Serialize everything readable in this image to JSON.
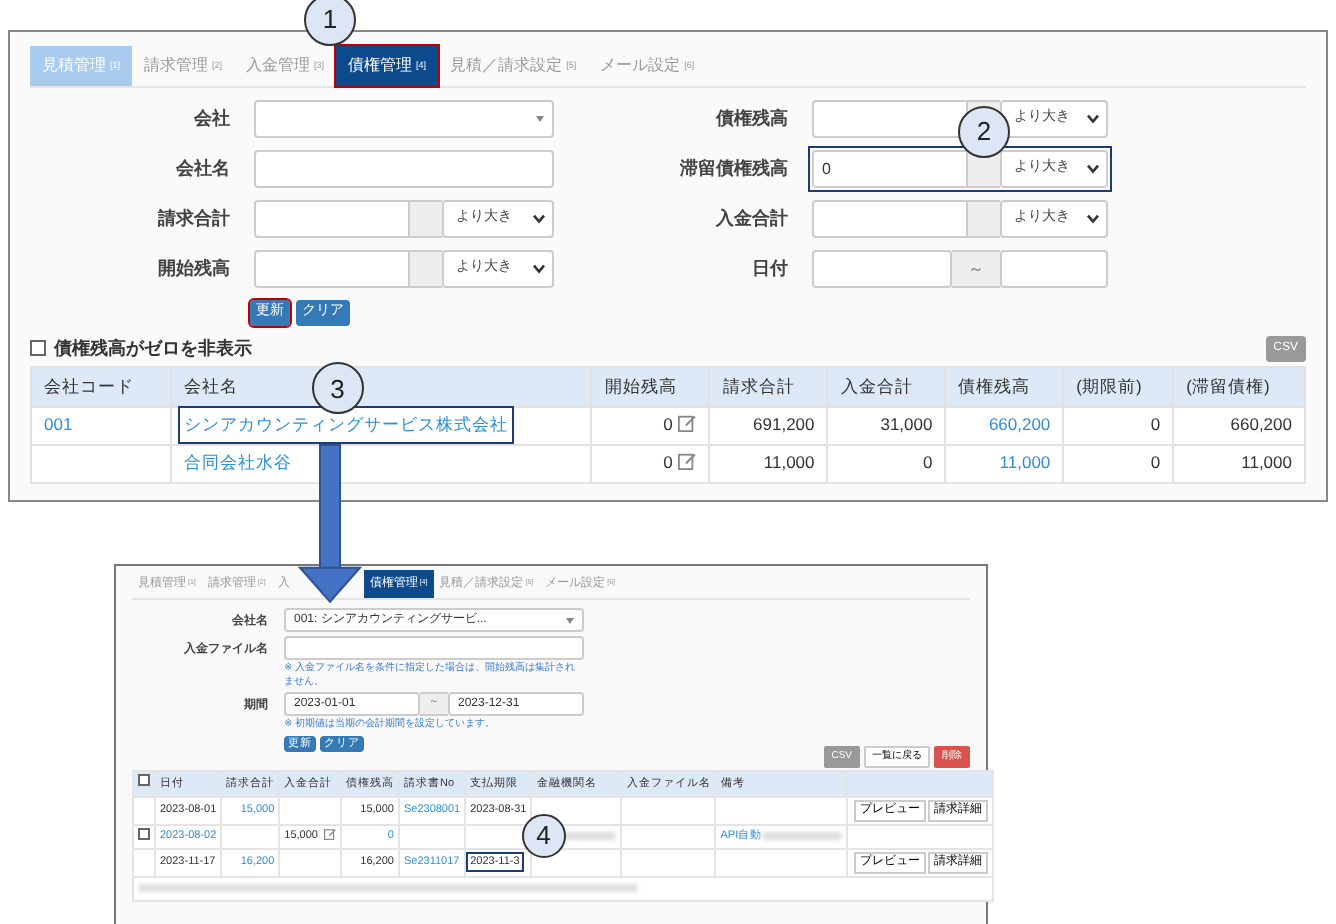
{
  "top_panel": {
    "tabs": [
      {
        "label": "見積管理",
        "count": "[1]",
        "selected": false,
        "hover": true
      },
      {
        "label": "請求管理",
        "count": "[2]",
        "selected": false,
        "hover": false
      },
      {
        "label": "入金管理",
        "count": "[3]",
        "selected": false,
        "hover": false
      },
      {
        "label": "債権管理",
        "count": "[4]",
        "selected": true,
        "hover": false,
        "highlighted": true
      },
      {
        "label": "見積／請求設定",
        "count": "[5]",
        "selected": false,
        "hover": false
      },
      {
        "label": "メール設定",
        "count": "[6]",
        "selected": false,
        "hover": false
      }
    ],
    "form_left": [
      {
        "label": "会社",
        "kind": "select"
      },
      {
        "label": "会社名",
        "kind": "text"
      },
      {
        "label": "請求合計",
        "kind": "range",
        "option": "より大き"
      },
      {
        "label": "開始残高",
        "kind": "range",
        "option": "より大き"
      }
    ],
    "form_right": [
      {
        "label": "債権残高",
        "kind": "range",
        "option": "より大き"
      },
      {
        "label": "滞留債権残高",
        "kind": "range",
        "value": "0",
        "option": "より大き",
        "highlighted": true
      },
      {
        "label": "入金合計",
        "kind": "range",
        "option": "より大き"
      },
      {
        "label": "日付",
        "kind": "daterange",
        "separator": "～"
      }
    ],
    "buttons": [
      {
        "label": "更新",
        "highlighted": true
      },
      {
        "label": "クリア"
      }
    ],
    "hide_zero": {
      "label": "債権残高がゼロを非表示",
      "checked": false
    },
    "csv": "CSV",
    "table": {
      "columns": [
        {
          "label": "会社コード",
          "kind": "link"
        },
        {
          "label": "会社名",
          "kind": "link"
        },
        {
          "label": "開始残高",
          "kind": "editable"
        },
        {
          "label": "請求合計",
          "kind": "number"
        },
        {
          "label": "入金合計",
          "kind": "number"
        },
        {
          "label": "債権残高",
          "kind": "linknumber"
        },
        {
          "label": "(期限前)",
          "kind": "number"
        },
        {
          "label": "(滞留債権)",
          "kind": "number"
        }
      ],
      "rows": [
        {
          "cells": [
            "001",
            {
              "text": "シンアカウンティングサービス株式会社",
              "highlighted": true
            },
            "0",
            "691,200",
            "31,000",
            "660,200",
            "0",
            "660,200"
          ]
        },
        {
          "cells": [
            "",
            "合同会社水谷",
            "0",
            "11,000",
            "0",
            "11,000",
            "0",
            "11,000"
          ]
        }
      ]
    }
  },
  "bottom_panel": {
    "tabs": [
      {
        "label": "見積管理",
        "count": "[1]",
        "selected": false
      },
      {
        "label": "請求管理",
        "count": "[2]",
        "selected": false
      },
      {
        "label": "入",
        "selected": false
      },
      {
        "label": "債権管理",
        "count": "[4]",
        "selected": true
      },
      {
        "label": "見積／請求設定",
        "count": "[5]",
        "selected": false
      },
      {
        "label": "メール設定",
        "count": "[6]",
        "selected": false
      }
    ],
    "company": {
      "label": "会社名",
      "value": "001: シンアカウンティングサービ..."
    },
    "file": {
      "label": "入金ファイル名",
      "note": "※ 入金ファイル名を条件に指定した場合は、開始残高は集計されません。"
    },
    "period": {
      "label": "期間",
      "from": "2023-01-01",
      "separator": "～",
      "to": "2023-12-31",
      "note": "※ 初期値は当期の会計期間を設定しています。"
    },
    "buttons": [
      "更新",
      "クリア"
    ],
    "actions": [
      {
        "label": "CSV",
        "kind": "secondary"
      },
      {
        "label": "一覧に戻る",
        "kind": "light"
      },
      {
        "label": "削除",
        "kind": "danger"
      }
    ],
    "table": {
      "select_all": {
        "checked": false
      },
      "columns": [
        "日付",
        "請求合計",
        "入金合計",
        "債権残高",
        "請求書No",
        "支払期限",
        "金融機関名",
        "入金ファイル名",
        "備考"
      ],
      "rows": [
        {
          "selectable": false,
          "cells": [
            "2023-08-01",
            {
              "text": "15,000",
              "link": true
            },
            "",
            "15,000",
            {
              "text": "Se2308001",
              "link": true
            },
            "2023-08-31",
            "",
            "",
            ""
          ],
          "buttons": [
            "プレビュー",
            "請求詳細"
          ]
        },
        {
          "selectable": true,
          "checked": false,
          "cells": [
            {
              "text": "2023-08-02",
              "link": true
            },
            "",
            {
              "text": "15,000",
              "edit": true
            },
            {
              "text": "0",
              "link": true
            },
            "",
            "",
            {
              "redacted": true
            },
            "",
            {
              "text": "API自動",
              "link": true,
              "redacted": true
            }
          ]
        },
        {
          "selectable": false,
          "cells": [
            "2023-11-17",
            {
              "text": "16,200",
              "link": true
            },
            "",
            "16,200",
            {
              "text": "Se2311017",
              "link": true
            },
            {
              "text": "2023-11-3",
              "highlighted": true
            },
            "",
            "",
            ""
          ],
          "buttons": [
            "プレビュー",
            "請求詳細"
          ]
        },
        {
          "redacted": true
        }
      ]
    }
  },
  "callouts": [
    "1",
    "2",
    "3",
    "4"
  ]
}
